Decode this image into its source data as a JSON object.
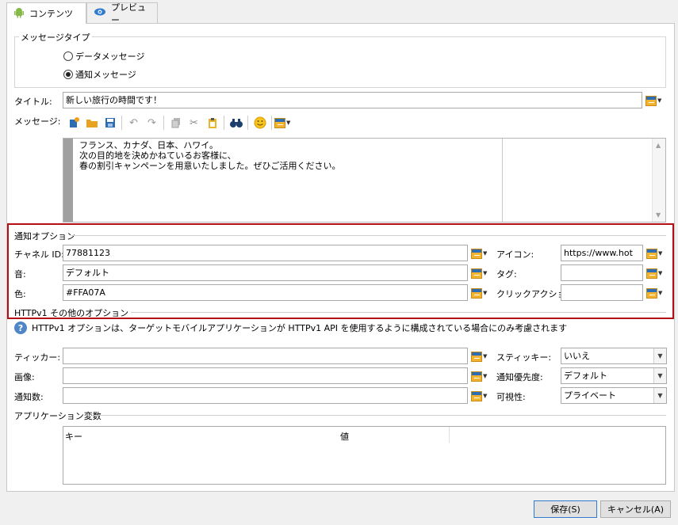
{
  "tabs": [
    {
      "label": "コンテンツ",
      "icon": "android-icon",
      "active": true
    },
    {
      "label": "プレビュー",
      "icon": "eye-icon",
      "active": false
    }
  ],
  "message_type": {
    "title": "メッセージタイプ",
    "options": [
      {
        "label": "データメッセージ",
        "checked": false
      },
      {
        "label": "通知メッセージ",
        "checked": true
      }
    ]
  },
  "title_field": {
    "label": "タイトル:",
    "value": "新しい旅行の時間です！"
  },
  "message_field": {
    "label": "メッセージ:",
    "lines": [
      "フランス、カナダ、日本、ハワイ。",
      "次の目的地を決めかねているお客様に、",
      "春の割引キャンペーンを用意いたしました。ぜひご活用ください。"
    ]
  },
  "notification_options": {
    "title": "通知オプション",
    "channel_id": {
      "label": "チャネル ID:",
      "value": "77881123"
    },
    "sound": {
      "label": "音:",
      "value": "デフォルト"
    },
    "color": {
      "label": "色:",
      "value": "#FFA07A"
    },
    "icon": {
      "label": "アイコン:",
      "value": "https://www.hot"
    },
    "tag": {
      "label": "タグ:",
      "value": ""
    },
    "click_action": {
      "label": "クリックアクション:",
      "value": ""
    }
  },
  "httpv1": {
    "title": "HTTPv1 その他のオプション",
    "info": "HTTPv1 オプションは、ターゲットモバイルアプリケーションが HTTPv1 API を使用するように構成されている場合にのみ考慮されます",
    "ticker": {
      "label": "ティッカー:",
      "value": ""
    },
    "image": {
      "label": "画像:",
      "value": ""
    },
    "notification_count": {
      "label": "通知数:",
      "value": ""
    },
    "sticky": {
      "label": "スティッキー:",
      "value": "いいえ"
    },
    "priority": {
      "label": "通知優先度:",
      "value": "デフォルト"
    },
    "visibility": {
      "label": "可視性:",
      "value": "プライベート"
    }
  },
  "app_variables": {
    "title": "アプリケーション変数",
    "columns": [
      "キー",
      "値"
    ]
  },
  "buttons": {
    "save": "保存(S)",
    "cancel": "キャンセル(A)"
  },
  "colors": {
    "highlight": "#b40f14",
    "accent": "#2f7bd0"
  }
}
